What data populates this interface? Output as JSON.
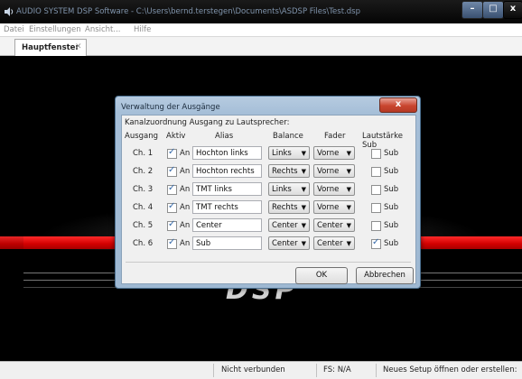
{
  "window": {
    "title": "AUDIO SYSTEM DSP Software - C:\\Users\\bernd.terstegen\\Documents\\ASDSP Files\\Test.dsp",
    "min_label": "–",
    "max_label": "□",
    "close_label": "x"
  },
  "menu": [
    "Datei",
    "Einstellungen",
    "Ansicht...",
    "Hilfe"
  ],
  "tab": {
    "label": "Hauptfenster",
    "close": "✕"
  },
  "logo_text": "DSP",
  "dialog": {
    "title": "Verwaltung der Ausgänge",
    "close_label": "x",
    "group_title": "Kanalzuordnung Ausgang zu Lautsprecher:",
    "headers": [
      "Ausgang",
      "Aktiv",
      "Alias",
      "Balance",
      "Fader",
      "Lautstärke Sub"
    ],
    "rows": [
      {
        "ch": "Ch. 1",
        "active": true,
        "active_label": "An",
        "alias": "Hochton links",
        "balance": "Links",
        "fader": "Vorne",
        "sub": false,
        "sub_label": "Sub"
      },
      {
        "ch": "Ch. 2",
        "active": true,
        "active_label": "An",
        "alias": "Hochton rechts",
        "balance": "Rechts",
        "fader": "Vorne",
        "sub": false,
        "sub_label": "Sub"
      },
      {
        "ch": "Ch. 3",
        "active": true,
        "active_label": "An",
        "alias": "TMT links",
        "balance": "Links",
        "fader": "Vorne",
        "sub": false,
        "sub_label": "Sub"
      },
      {
        "ch": "Ch. 4",
        "active": true,
        "active_label": "An",
        "alias": "TMT rechts",
        "balance": "Rechts",
        "fader": "Vorne",
        "sub": false,
        "sub_label": "Sub"
      },
      {
        "ch": "Ch. 5",
        "active": true,
        "active_label": "An",
        "alias": "Center",
        "balance": "Center",
        "fader": "Center",
        "sub": false,
        "sub_label": "Sub"
      },
      {
        "ch": "Ch. 6",
        "active": true,
        "active_label": "An",
        "alias": "Sub",
        "balance": "Center",
        "fader": "Center",
        "sub": true,
        "sub_label": "Sub"
      }
    ],
    "ok_label": "OK",
    "cancel_label": "Abbrechen"
  },
  "status": {
    "connection": "Nicht verbunden",
    "fs": "FS: N/A",
    "hint": "Neues Setup öffnen oder erstellen:"
  },
  "colors": {
    "accent_red": "#e00000",
    "titlebar": "#0a0a0a",
    "check_blue": "#3468a8"
  }
}
